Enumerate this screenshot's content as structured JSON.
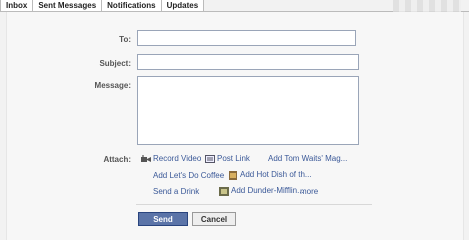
{
  "tabs": [
    "Inbox",
    "Sent Messages",
    "Notifications",
    "Updates"
  ],
  "form": {
    "to_label": "To:",
    "to_value": "",
    "subject_label": "Subject:",
    "subject_value": "",
    "message_label": "Message:",
    "message_value": "",
    "attach_label": "Attach:"
  },
  "attachments": [
    {
      "label": "Record Video",
      "icon": "video-camera-icon"
    },
    {
      "label": "Post Link",
      "icon": "link-icon"
    },
    {
      "label": "Add Tom Waits' Mag...",
      "icon": ""
    },
    {
      "label": "Add Let's Do Coffee",
      "icon": ""
    },
    {
      "label": "Add Hot Dish of th...",
      "icon": "hot-dish-icon"
    },
    {
      "label": "Send a Drink",
      "icon": ""
    },
    {
      "label": "Add Dunder-Mifflin...",
      "icon": "dunder-mifflin-icon"
    },
    {
      "label": "more",
      "icon": ""
    }
  ],
  "buttons": {
    "send": "Send",
    "cancel": "Cancel"
  },
  "colors": {
    "link": "#3b5998",
    "send_button": "#5b74a8"
  }
}
